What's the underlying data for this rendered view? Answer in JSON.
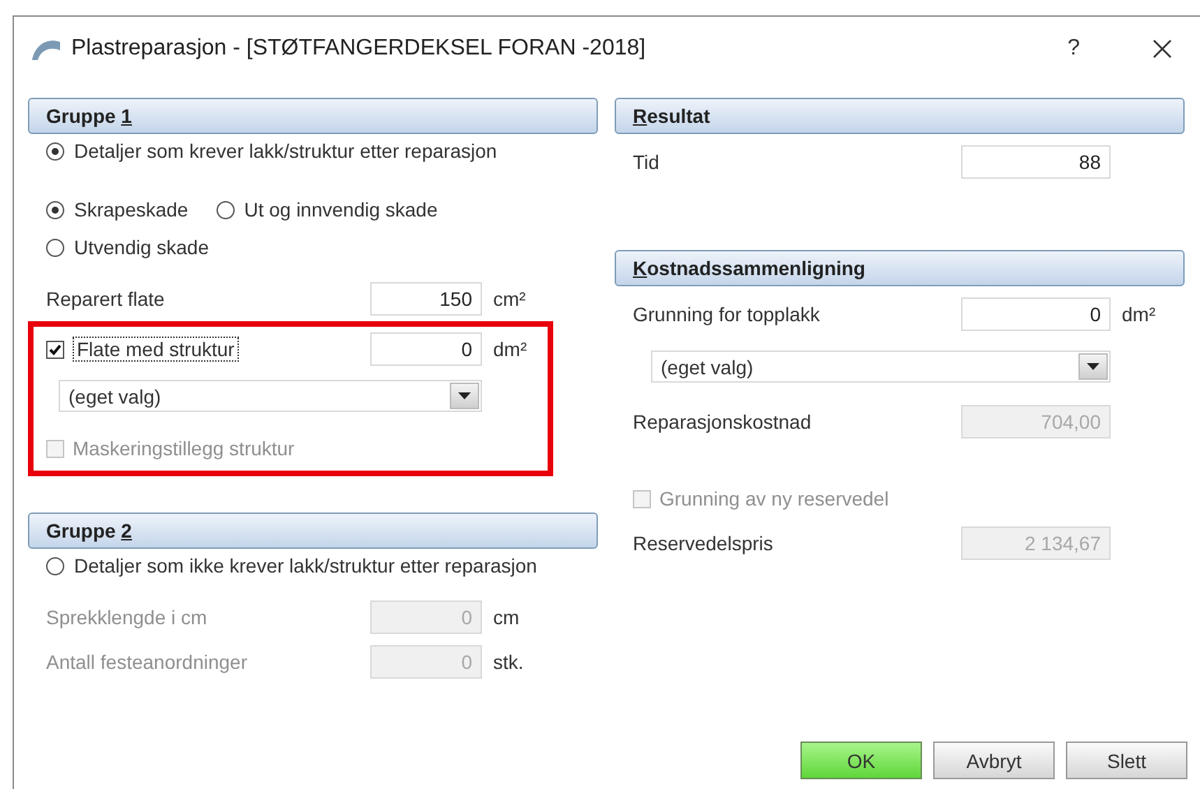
{
  "window": {
    "title": "Plastreparasjon - [STØTFANGERDEKSEL FORAN -2018]",
    "help": "?"
  },
  "columns": [
    {
      "sections": [
        {
          "heading": {
            "before": "Gruppe ",
            "key": "1"
          },
          "items": [
            {
              "kind": "radio",
              "label": "Detaljer som krever lakk/struktur etter reparasjon",
              "selected": true
            },
            {
              "kind": "radio_row",
              "options": [
                {
                  "label": "Skrapeskade",
                  "selected": true
                },
                {
                  "label": "Ut og innvendig skade",
                  "selected": false
                }
              ]
            },
            {
              "kind": "radio",
              "label": "Utvendig skade",
              "selected": false
            },
            {
              "kind": "field",
              "label": "Reparert flate",
              "value": "150",
              "unit": "cm²",
              "disabled": false,
              "label_greyed": false
            },
            {
              "kind": "highlight",
              "items": [
                {
                  "kind": "check_field",
                  "label": "Flate med struktur",
                  "checked": true,
                  "focused": true,
                  "value": "0",
                  "unit": "dm²"
                },
                {
                  "kind": "dropdown",
                  "value": "(eget valg)"
                },
                {
                  "kind": "checkbox",
                  "label": "Maskeringstillegg struktur",
                  "checked": false,
                  "disabled": true
                }
              ]
            }
          ]
        },
        {
          "heading": {
            "before": "Gruppe ",
            "key": "2"
          },
          "items": [
            {
              "kind": "radio",
              "label": "Detaljer som ikke krever lakk/struktur etter reparasjon",
              "selected": false
            },
            {
              "kind": "field",
              "label": "Sprekklengde i cm",
              "value": "0",
              "unit": "cm",
              "disabled": true,
              "label_greyed": true
            },
            {
              "kind": "field",
              "label": "Antall festeanordninger",
              "value": "0",
              "unit": "stk.",
              "disabled": true,
              "label_greyed": true
            }
          ]
        }
      ]
    },
    {
      "sections": [
        {
          "heading": {
            "key": "R",
            "after": "esultat"
          },
          "items": [
            {
              "kind": "field",
              "label": "Tid",
              "value": "88",
              "disabled": false,
              "label_greyed": false
            }
          ]
        },
        {
          "heading": {
            "key": "K",
            "after": "ostnadssammenligning"
          },
          "items": [
            {
              "kind": "field",
              "label": "Grunning for topplakk",
              "value": "0",
              "unit": "dm²",
              "disabled": false,
              "label_greyed": false
            },
            {
              "kind": "dropdown",
              "value": "(eget valg)"
            },
            {
              "kind": "field",
              "label": "Reparasjonskostnad",
              "value": "704,00",
              "disabled": true,
              "label_greyed": false
            },
            {
              "kind": "checkbox",
              "label": "Grunning av ny reservedel",
              "checked": false,
              "disabled": true
            },
            {
              "kind": "field",
              "label": "Reservedelspris",
              "value": "2 134,67",
              "disabled": true,
              "label_greyed": false
            }
          ]
        }
      ]
    }
  ],
  "buttons": [
    {
      "label": "OK",
      "kind": "default"
    },
    {
      "label": "Avbryt",
      "kind": "normal"
    },
    {
      "label": "Slett",
      "kind": "normal"
    }
  ]
}
